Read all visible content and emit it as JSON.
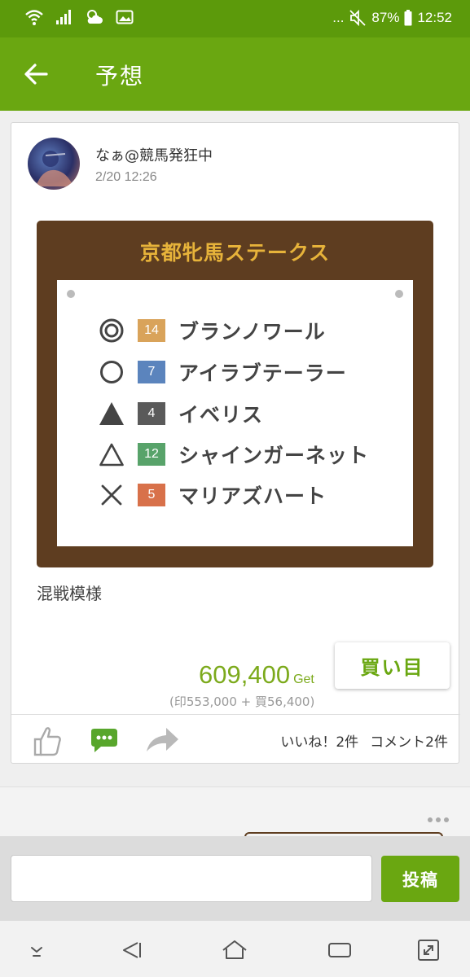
{
  "status_bar": {
    "battery": "87%",
    "time": "12:52",
    "indicators": "...",
    "icons": [
      "wifi-icon",
      "signal-icon",
      "weather-icon",
      "image-icon",
      "mute-icon",
      "battery-icon"
    ]
  },
  "app_bar": {
    "title": "予想",
    "back_icon": "arrow-left-icon"
  },
  "post": {
    "user_name": "なぁ@競馬発狂中",
    "date": "2/20 12:26",
    "race_name": "京都牝馬ステークス",
    "picks": [
      {
        "mark": "double-circle",
        "number": "14",
        "horse": "ブランノワール",
        "color": "#d9a35a"
      },
      {
        "mark": "circle",
        "number": "7",
        "horse": "アイラブテーラー",
        "color": "#5b84bd"
      },
      {
        "mark": "filled-triangle",
        "number": "4",
        "horse": "イベリス",
        "color": "#5a5a5a"
      },
      {
        "mark": "triangle",
        "number": "12",
        "horse": "シャインガーネット",
        "color": "#58a36a"
      },
      {
        "mark": "cross",
        "number": "5",
        "horse": "マリアズハート",
        "color": "#d8714a"
      }
    ],
    "comment": "混戦模様",
    "buy_button": "買い目",
    "points": "609,400",
    "points_unit": "Get",
    "points_breakdown": "(印553,000 + 買56,400)",
    "likes": "いいね！2件",
    "comments": "コメント2件"
  },
  "comment_form": {
    "value": "",
    "submit": "投稿"
  },
  "colors": {
    "primary": "#6aa711",
    "status": "#5c9a0b",
    "board": "#5e3d20",
    "race_title": "#e7b33a",
    "score": "#7caa1c"
  }
}
